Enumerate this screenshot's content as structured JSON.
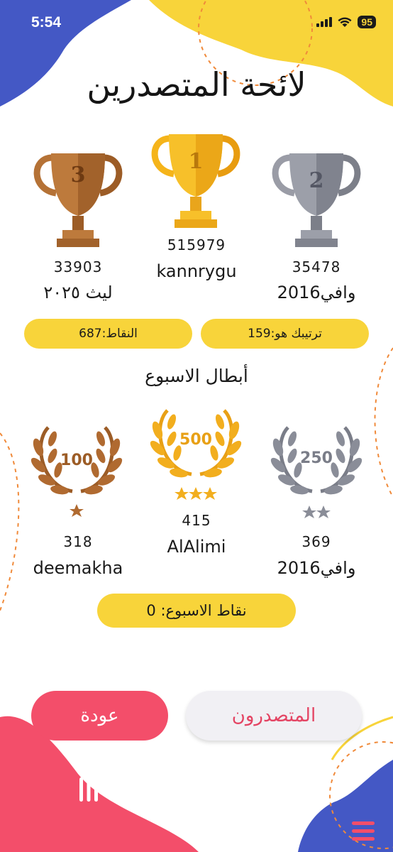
{
  "status": {
    "time": "5:54",
    "battery": "95"
  },
  "title": "لائحة المتصدرين",
  "podium": [
    {
      "rank_label": "1",
      "score": "515979",
      "name": "kannrygu",
      "medal": "gold"
    },
    {
      "rank_label": "2",
      "score": "35478",
      "name": "وافي2016",
      "medal": "silver"
    },
    {
      "rank_label": "3",
      "score": "33903",
      "name": "ليث ٢٠٢٥",
      "medal": "bronze"
    }
  ],
  "stats": {
    "rank": "ترتيبك هو:159",
    "points": "النقاط:687"
  },
  "weekly": {
    "title": "أبطال الاسبوع",
    "heroes": [
      {
        "badge": "500",
        "score": "415",
        "name": "AlAlimi",
        "stars": 3
      },
      {
        "badge": "250",
        "score": "369",
        "name": "وافي2016",
        "stars": 2
      },
      {
        "badge": "100",
        "score": "318",
        "name": "deemakha",
        "stars": 1
      }
    ],
    "points": "نقاط الاسبوع: 0"
  },
  "buttons": {
    "back": "عودة",
    "leaders": "المتصدرون"
  },
  "colors": {
    "accent_yellow": "#f8d43a",
    "accent_pink": "#f34e6a",
    "accent_blue": "#4458c5",
    "gold": "#f5b41a",
    "silver": "#8a8d98",
    "bronze": "#b06a30"
  },
  "icons": {
    "menu_bottom_left": "bars-icon",
    "menu_bottom_right": "hamburger-icon"
  }
}
